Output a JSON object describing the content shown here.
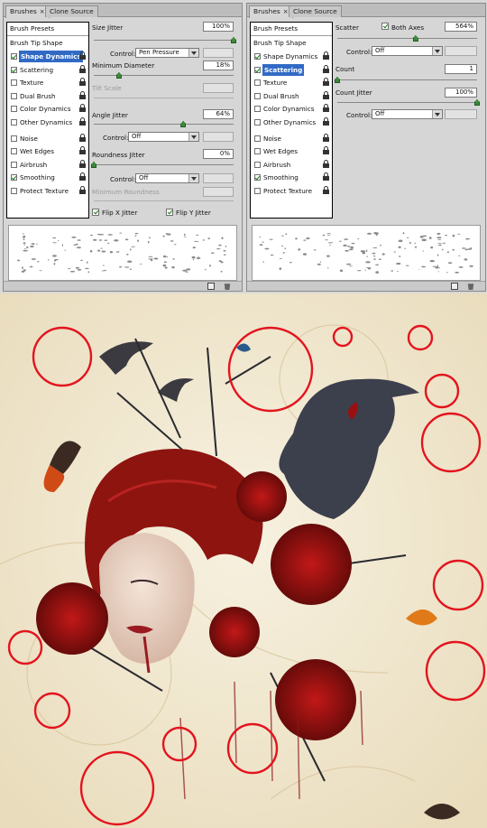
{
  "left_panel": {
    "tabs": [
      {
        "label": "Brushes",
        "close": "×",
        "active": true
      },
      {
        "label": "Clone Source",
        "active": false
      }
    ],
    "sidebar": {
      "header": "Brush Presets",
      "tip_shape": "Brush Tip Shape",
      "items": [
        {
          "label": "Shape Dynamics",
          "checked": true,
          "selected": true
        },
        {
          "label": "Scattering",
          "checked": true,
          "selected": false
        },
        {
          "label": "Texture",
          "checked": false,
          "selected": false
        },
        {
          "label": "Dual Brush",
          "checked": false,
          "selected": false
        },
        {
          "label": "Color Dynamics",
          "checked": false,
          "selected": false
        },
        {
          "label": "Other Dynamics",
          "checked": false,
          "selected": false
        },
        {
          "label": "Noise",
          "checked": false,
          "selected": false
        },
        {
          "label": "Wet Edges",
          "checked": false,
          "selected": false
        },
        {
          "label": "Airbrush",
          "checked": false,
          "selected": false
        },
        {
          "label": "Smoothing",
          "checked": true,
          "selected": false
        },
        {
          "label": "Protect Texture",
          "checked": false,
          "selected": false
        }
      ]
    },
    "settings": {
      "size_jitter": {
        "label": "Size Jitter",
        "value": "100%",
        "fraction": 1.0
      },
      "size_control": {
        "label": "Control:",
        "value": "Pen Pressure"
      },
      "min_diameter": {
        "label": "Minimum Diameter",
        "value": "18%",
        "fraction": 0.18
      },
      "tilt_scale": {
        "label": "Tilt Scale"
      },
      "angle_jitter": {
        "label": "Angle Jitter",
        "value": "64%",
        "fraction": 0.64
      },
      "angle_control": {
        "label": "Control:",
        "value": "Off"
      },
      "roundness_jitter": {
        "label": "Roundness Jitter",
        "value": "0%",
        "fraction": 0.0
      },
      "roundness_control": {
        "label": "Control:",
        "value": "Off"
      },
      "min_roundness": {
        "label": "Minimum Roundness"
      },
      "flip_x": {
        "label": "Flip X Jitter",
        "checked": true
      },
      "flip_y": {
        "label": "Flip Y Jitter",
        "checked": true
      }
    }
  },
  "right_panel": {
    "tabs": [
      {
        "label": "Brushes",
        "close": "×",
        "active": true
      },
      {
        "label": "Clone Source",
        "active": false
      }
    ],
    "sidebar": {
      "header": "Brush Presets",
      "tip_shape": "Brush Tip Shape",
      "items": [
        {
          "label": "Shape Dynamics",
          "checked": true,
          "selected": false
        },
        {
          "label": "Scattering",
          "checked": true,
          "selected": true
        },
        {
          "label": "Texture",
          "checked": false,
          "selected": false
        },
        {
          "label": "Dual Brush",
          "checked": false,
          "selected": false
        },
        {
          "label": "Color Dynamics",
          "checked": false,
          "selected": false
        },
        {
          "label": "Other Dynamics",
          "checked": false,
          "selected": false
        },
        {
          "label": "Noise",
          "checked": false,
          "selected": false
        },
        {
          "label": "Wet Edges",
          "checked": false,
          "selected": false
        },
        {
          "label": "Airbrush",
          "checked": false,
          "selected": false
        },
        {
          "label": "Smoothing",
          "checked": true,
          "selected": false
        },
        {
          "label": "Protect Texture",
          "checked": false,
          "selected": false
        }
      ]
    },
    "settings": {
      "scatter": {
        "label": "Scatter",
        "value": "564%",
        "fraction": 0.56
      },
      "both_axes": {
        "label": "Both Axes",
        "checked": true
      },
      "scatter_control": {
        "label": "Control:",
        "value": "Off"
      },
      "count": {
        "label": "Count",
        "value": "1",
        "fraction": 0.0
      },
      "count_jitter": {
        "label": "Count Jitter",
        "value": "100%",
        "fraction": 1.0
      },
      "count_control": {
        "label": "Control:",
        "value": "Off"
      }
    }
  },
  "colors": {
    "panel_bg": "#d6d6d6",
    "selected_item": "#316ac5",
    "circle_red": "#e3141e",
    "artwork_bg": "#f1ead6",
    "hair_red": "#8e1410"
  }
}
